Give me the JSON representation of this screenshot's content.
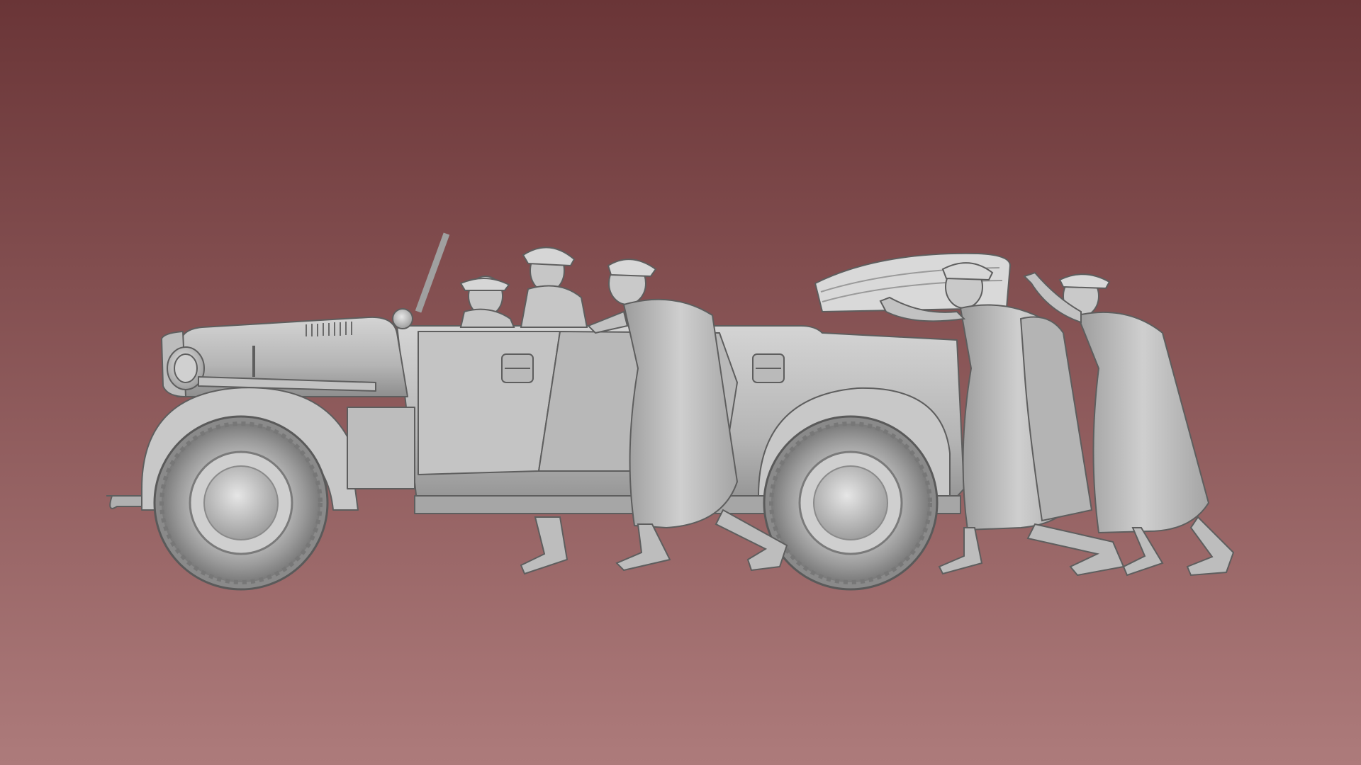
{
  "scene": {
    "subject": "grey-clay-render",
    "vehicle": "open-top-staff-car",
    "figure_count": 6
  },
  "colors": {
    "background_top": "#6a3537",
    "background_bottom": "#ad7b7b",
    "model_light": "#d8d8d8",
    "model_mid": "#a9a9a9",
    "model_dark": "#6f6f6f",
    "model_outline": "#555555"
  }
}
